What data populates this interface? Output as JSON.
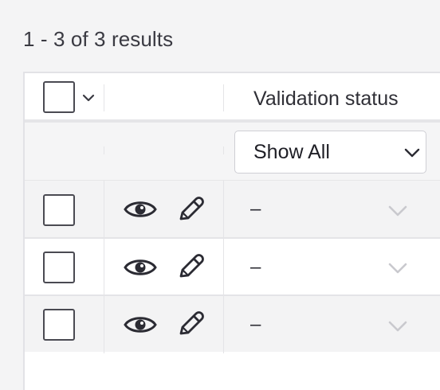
{
  "results": {
    "count_text": "1 - 3 of 3 results"
  },
  "table": {
    "header": {
      "validation_status_label": "Validation status"
    },
    "filter": {
      "selected": "Show All"
    },
    "rows": [
      {
        "validation_status": "–"
      },
      {
        "validation_status": "–"
      },
      {
        "validation_status": "–"
      }
    ]
  },
  "icons": {
    "view": "eye-icon",
    "edit": "pencil-icon",
    "dropdown": "chevron-down-icon"
  },
  "colors": {
    "background": "#f4f4f5",
    "row_alt": "#f3f3f4",
    "border": "#e4e4e7",
    "icon": "#2b2b33",
    "chevron_muted": "#c9c9ce"
  }
}
